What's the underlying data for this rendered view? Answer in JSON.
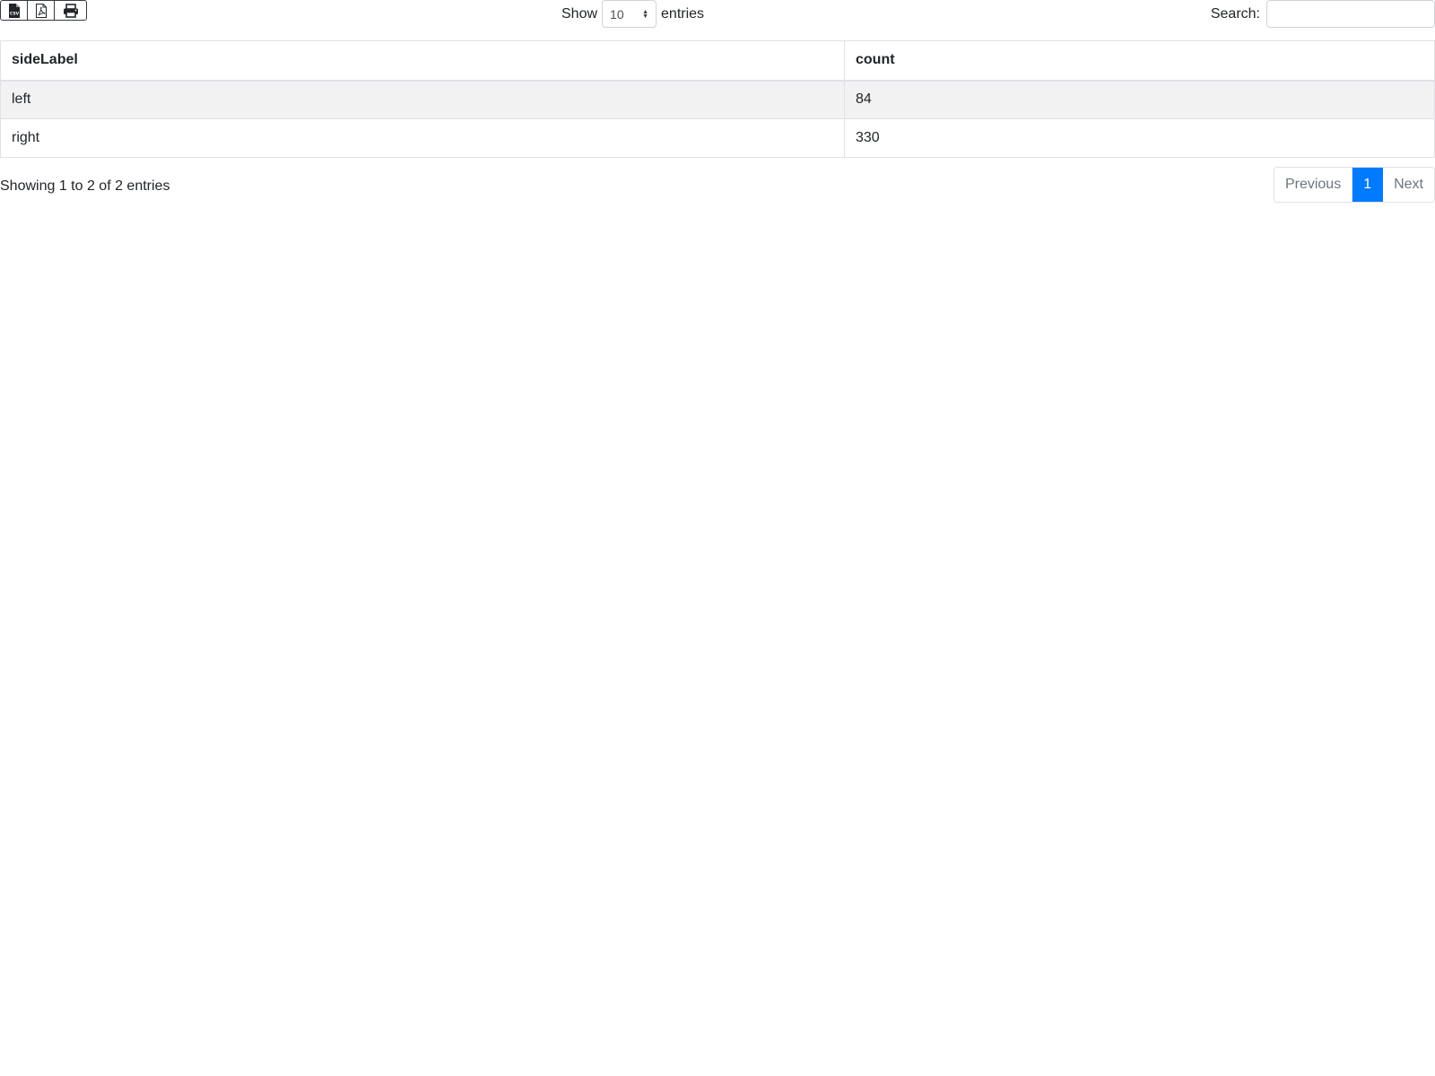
{
  "export": {
    "buttons": [
      {
        "name": "csv-export-button",
        "icon": "csv-file-icon"
      },
      {
        "name": "pdf-export-button",
        "icon": "pdf-file-icon"
      },
      {
        "name": "print-button",
        "icon": "printer-icon"
      }
    ]
  },
  "length": {
    "label_before": "Show",
    "selected": "10",
    "label_after": "entries"
  },
  "search": {
    "label": "Search:",
    "value": "",
    "placeholder": ""
  },
  "table": {
    "headers": [
      "sideLabel",
      "count"
    ],
    "rows": [
      [
        "left",
        "84"
      ],
      [
        "right",
        "330"
      ]
    ]
  },
  "info": "Showing 1 to 2 of 2 entries",
  "pagination": {
    "previous": "Previous",
    "current": "1",
    "next": "Next",
    "active_color": "#007bff"
  }
}
